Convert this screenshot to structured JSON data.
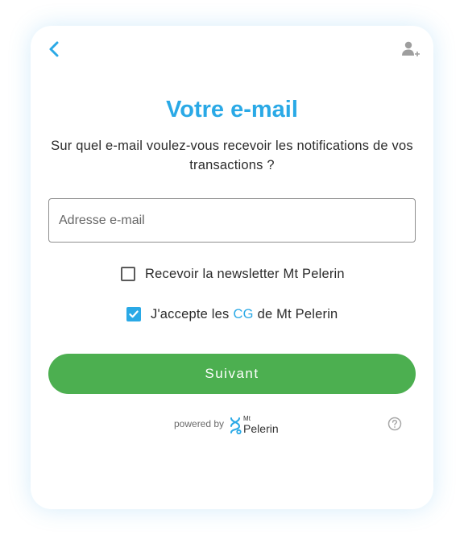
{
  "header": {
    "back_icon": "chevron-left-icon",
    "account_icon": "person-add-icon"
  },
  "title": "Votre e-mail",
  "subtitle": "Sur quel e-mail voulez-vous recevoir les notifications de vos transactions ?",
  "email": {
    "placeholder": "Adresse e-mail",
    "value": ""
  },
  "newsletter": {
    "label": "Recevoir la newsletter Mt Pelerin",
    "checked": false
  },
  "terms": {
    "label_before": "J'accepte les",
    "link": "CG",
    "label_after": "de Mt Pelerin",
    "checked": true
  },
  "submit_label": "Suivant",
  "footer": {
    "powered_by": "powered by",
    "brand_small": "Mt",
    "brand_name": "Pelerin",
    "help_icon": "help-circle-icon"
  },
  "colors": {
    "accent": "#2aa9e6",
    "button": "#4caf50"
  }
}
